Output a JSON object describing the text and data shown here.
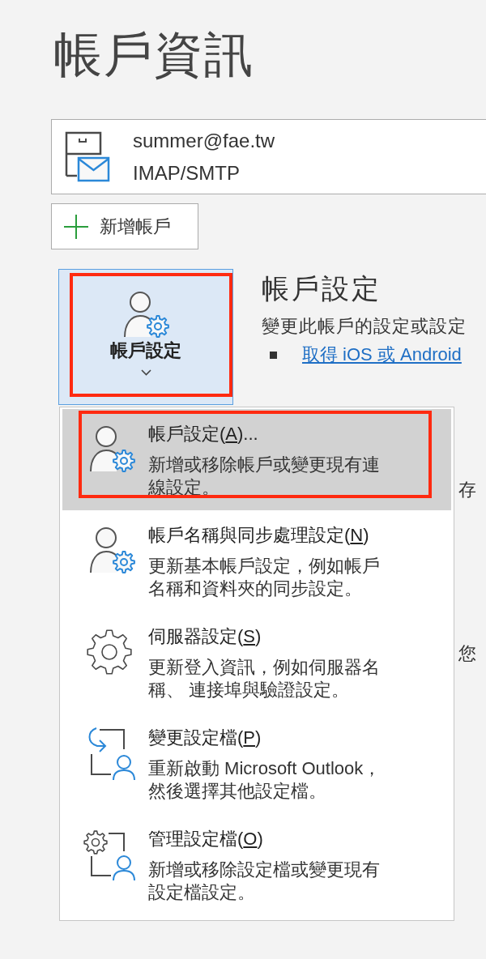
{
  "page": {
    "title": "帳戶資訊"
  },
  "account": {
    "email": "summer@fae.tw",
    "type": "IMAP/SMTP"
  },
  "add_account_button": {
    "label": "新增帳戶"
  },
  "account_settings_button": {
    "label": "帳戶設定",
    "expanded": true,
    "highlighted": true
  },
  "account_settings_section": {
    "heading": "帳戶設定",
    "description": "變更此帳戶的設定或設定",
    "link": "取得 iOS 或 Android"
  },
  "account_settings_menu": {
    "items": [
      {
        "kind": "person-gear",
        "title": "帳戶設定(",
        "access_key": "A",
        "title_end": ")...",
        "description": "新增或移除帳戶或變更現有連線設定。",
        "selected": true,
        "highlighted": true
      },
      {
        "kind": "person-gear",
        "title": "帳戶名稱與同步處理設定(",
        "access_key": "N",
        "title_end": ")",
        "description": "更新基本帳戶設定，例如帳戶名稱和資料夾的同步設定。",
        "selected": false,
        "highlighted": false
      },
      {
        "kind": "gear",
        "title": "伺服器設定(",
        "access_key": "S",
        "title_end": ")",
        "description": "更新登入資訊，例如伺服器名稱、 連接埠與驗證設定。",
        "selected": false,
        "highlighted": false
      },
      {
        "kind": "switch-profile",
        "title": "變更設定檔(",
        "access_key": "P",
        "title_end": ")",
        "description": "重新啟動 Microsoft Outlook，然後選擇其他設定檔。",
        "selected": false,
        "highlighted": false
      },
      {
        "kind": "manage-profile",
        "title": "管理設定檔(",
        "access_key": "O",
        "title_end": ")",
        "description": "新增或移除設定檔或變更現有設定檔設定。",
        "selected": false,
        "highlighted": false
      }
    ]
  },
  "obscured_text_fragments": [
    "存",
    "您"
  ]
}
